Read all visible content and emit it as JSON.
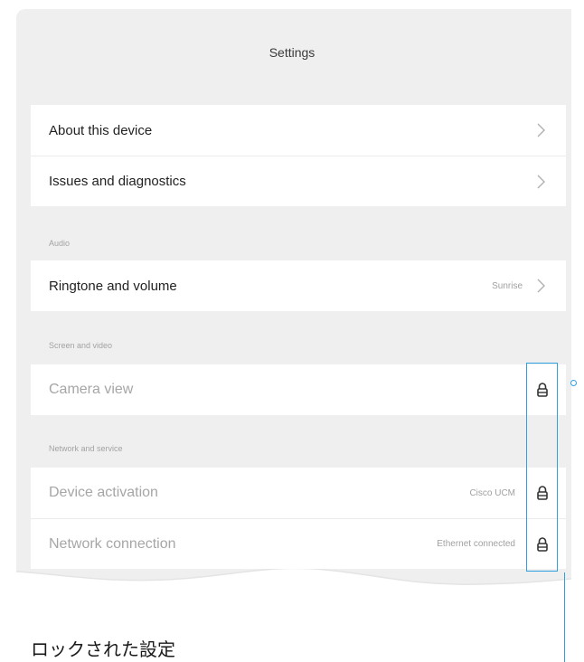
{
  "header": {
    "title": "Settings"
  },
  "general": {
    "items": [
      {
        "label": "About this device"
      },
      {
        "label": "Issues and diagnostics"
      }
    ]
  },
  "audio": {
    "section_label": "Audio",
    "items": [
      {
        "label": "Ringtone and volume",
        "value": "Sunrise"
      }
    ]
  },
  "screen_video": {
    "section_label": "Screen and video",
    "items": [
      {
        "label": "Camera view",
        "locked": true
      }
    ]
  },
  "network_service": {
    "section_label": "Network and service",
    "items": [
      {
        "label": "Device activation",
        "value": "Cisco UCM",
        "locked": true
      },
      {
        "label": "Network connection",
        "value": "Ethernet connected",
        "locked": true
      }
    ]
  },
  "annotation": {
    "caption": "ロックされた設定"
  },
  "colors": {
    "panel_bg": "#efefef",
    "card_bg": "#ffffff",
    "accent": "#2fa0e0",
    "locked_text": "#a6a6a6"
  },
  "icons": {
    "chevron": "chevron-right-icon",
    "lock": "lock-icon"
  }
}
